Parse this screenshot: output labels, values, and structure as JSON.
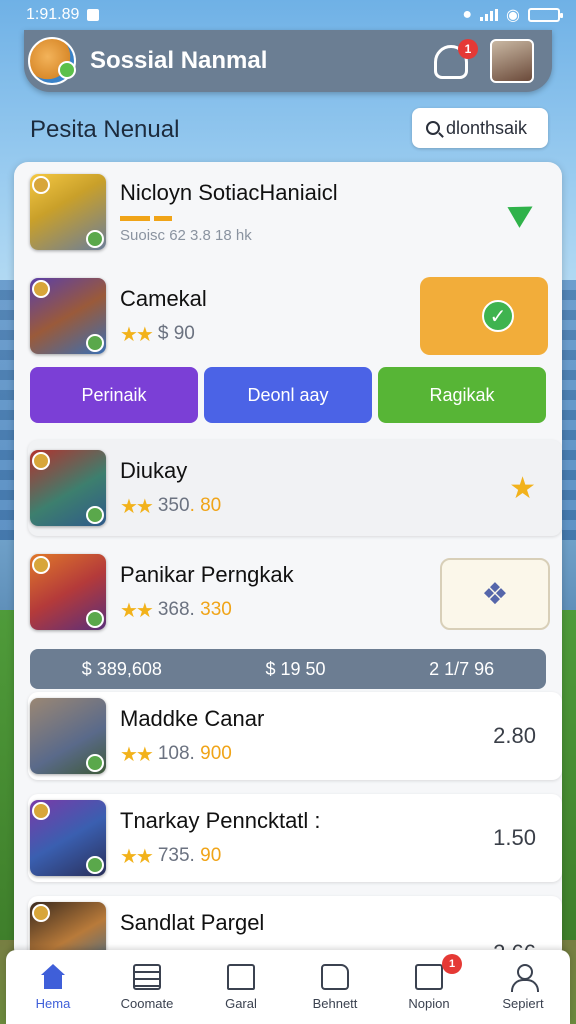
{
  "status_bar": {
    "time": "1:91.89",
    "battery_level": 1.0
  },
  "header": {
    "title": "Sossial Nanmal",
    "notification_count": "1",
    "logo_icon": "fox-logo-icon",
    "avatar_icon": "cat-avatar-icon"
  },
  "section": {
    "title": "Pesita Nenual",
    "search_label": "dlonthsaik"
  },
  "featured": {
    "name": "Nicloyn SotiacHaniaicl",
    "sub": "Suoisc 62 3.8 18 hk"
  },
  "games": [
    {
      "name": "Camekal",
      "stars": "★★",
      "value": "$ 90"
    },
    {
      "name": "Diukay",
      "stars": "★★",
      "value": "350",
      "value_hl": ". 80"
    },
    {
      "name": "Panikar Perngkak",
      "stars": "★★",
      "value": "368.",
      "value_hl": " 330"
    },
    {
      "name": "Maddke Canar",
      "stars": "★★",
      "value": "108.",
      "value_hl": " 900",
      "price": "2.80"
    },
    {
      "name": "Tnarkay Penncktatl :",
      "stars": "★★",
      "value": "735.",
      "value_hl": " 90",
      "price": "1.50"
    },
    {
      "name": "Sandlat Pargel",
      "stars": "★★",
      "value": "",
      "value_hl": "",
      "price": "2.66"
    }
  ],
  "actions": {
    "btn1": "Perinaik",
    "btn2": "Deonl aay",
    "btn3": "Ragikak",
    "colors": {
      "purple": "#7b3fd6",
      "blue": "#4b63e6",
      "green": "#57b536"
    }
  },
  "summary": {
    "a": "$ 389,608",
    "b": "$ 19 50",
    "c": "2 1/7 96"
  },
  "nav": {
    "items": [
      {
        "label": "Hema",
        "icon": "home-icon"
      },
      {
        "label": "Coomate",
        "icon": "list-icon"
      },
      {
        "label": "Garal",
        "icon": "store-icon"
      },
      {
        "label": "Behnett",
        "icon": "bag-icon"
      },
      {
        "label": "Nopion",
        "icon": "news-icon"
      },
      {
        "label": "Sepiert",
        "icon": "user-icon"
      }
    ],
    "news_badge": "1"
  }
}
